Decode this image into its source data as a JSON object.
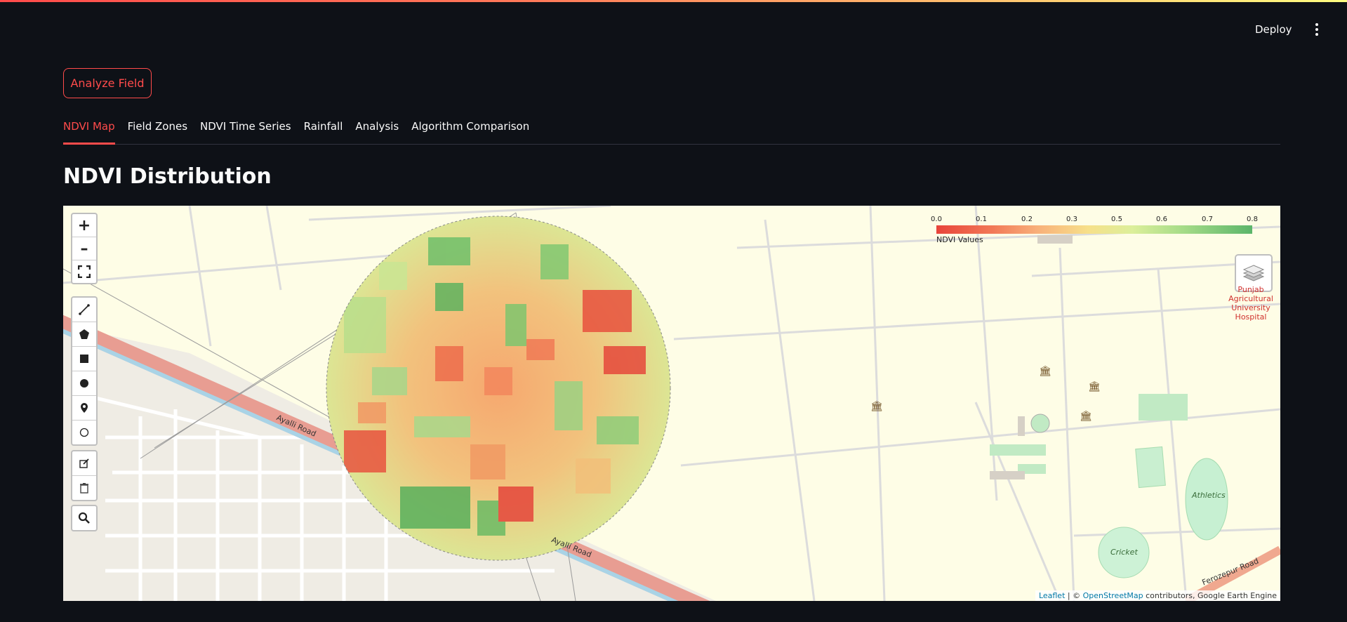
{
  "header": {
    "deploy_label": "Deploy",
    "menu_icon": "kebab-menu-icon"
  },
  "actions": {
    "analyze_label": "Analyze Field"
  },
  "tabs": [
    {
      "label": "NDVI Map",
      "active": true
    },
    {
      "label": "Field Zones",
      "active": false
    },
    {
      "label": "NDVI Time Series",
      "active": false
    },
    {
      "label": "Rainfall",
      "active": false
    },
    {
      "label": "Analysis",
      "active": false
    },
    {
      "label": "Algorithm Comparison",
      "active": false
    }
  ],
  "page": {
    "title": "NDVI Distribution"
  },
  "map": {
    "legend": {
      "ticks": [
        "0.0",
        "0.1",
        "0.2",
        "0.3",
        "0.5",
        "0.6",
        "0.7",
        "0.8"
      ],
      "label": "NDVI Values",
      "colors": [
        "#e8443a",
        "#f8b07a",
        "#f7e08a",
        "#a6dc88",
        "#5bb56a"
      ]
    },
    "labels": {
      "hospital": "Punjab Agricultural University Hospital",
      "athletics": "Athletics",
      "cricket": "Cricket",
      "ayalli_road": "Ayalli Road",
      "ferozepur_road": "Ferozepur Road",
      "ayalli_road_lower": "Ayalli Road"
    },
    "attribution": {
      "leaflet": "Leaflet",
      "sep": "| ©",
      "osm": "OpenStreetMap",
      "rest": "contributors, Google Earth Engine"
    },
    "controls": {
      "zoom_in": "+",
      "zoom_out": "–"
    }
  }
}
